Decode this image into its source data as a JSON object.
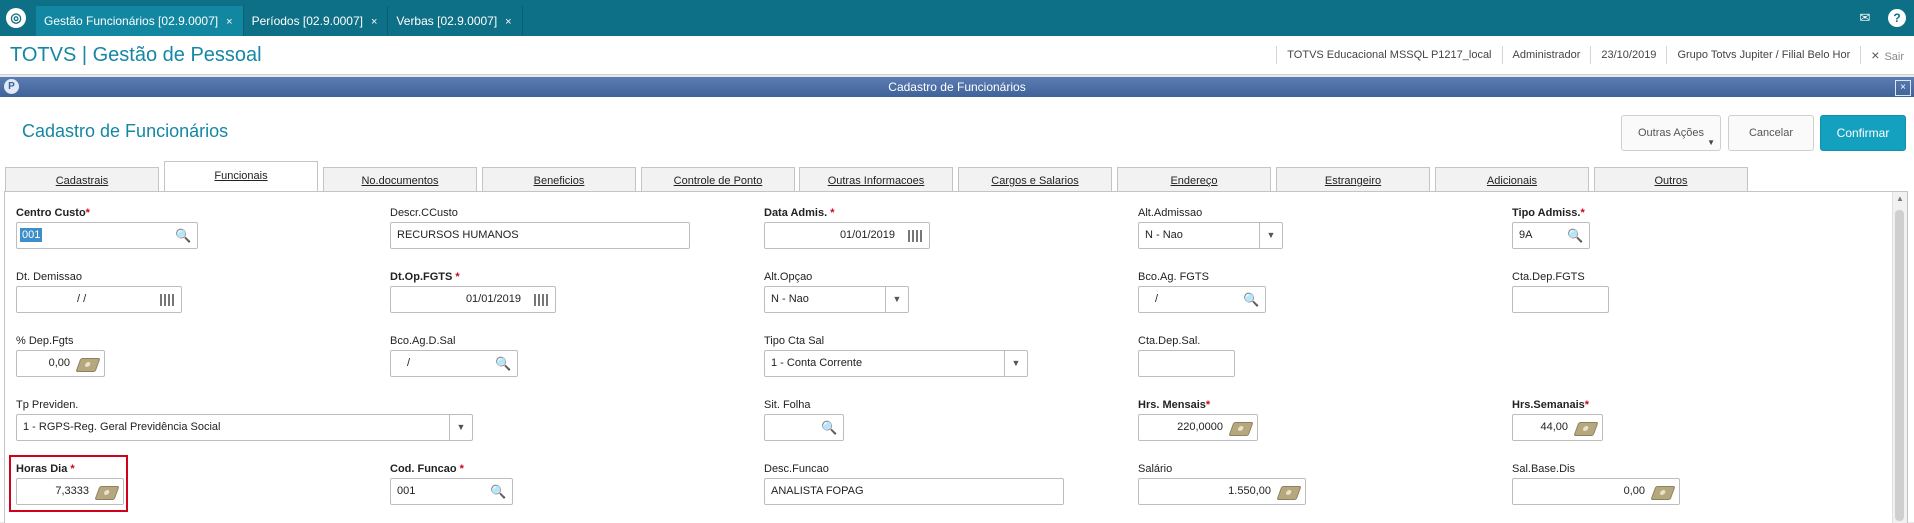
{
  "topbar": {
    "tabs": [
      {
        "label": "Gestão Funcionários [02.9.0007]",
        "close": "×"
      },
      {
        "label": "Períodos [02.9.0007]",
        "close": "×"
      },
      {
        "label": "Verbas [02.9.0007]",
        "close": "×"
      }
    ],
    "icons": [
      "mail-icon",
      "help-icon"
    ]
  },
  "appbar": {
    "title": "TOTVS | Gestão de Pessoal",
    "environment": "TOTVS Educacional MSSQL P1217_local",
    "user": "Administrador",
    "date": "23/10/2019",
    "company": "Grupo Totvs Jupiter / Filial Belo Hor",
    "logout": "Sair",
    "logout_icon": "×"
  },
  "dialog": {
    "window_title": "Cadastro de Funcionários",
    "title": "Cadastro de Funcionários",
    "actions": {
      "more": "Outras Ações",
      "cancel": "Cancelar",
      "confirm": "Confirmar"
    },
    "tabs": [
      "Cadastrais",
      "Funcionais",
      "No.documentos",
      "Beneficios",
      "Controle de Ponto",
      "Outras Informacoes",
      "Cargos e Salarios",
      "Endereço",
      "Estrangeiro",
      "Adicionais",
      "Outros"
    ],
    "active_tab": "Funcionais"
  },
  "fields": {
    "centro_custo": {
      "label": "Centro Custo",
      "required": "*",
      "value": "001"
    },
    "descr_ccusto": {
      "label": "Descr.CCusto",
      "value": "RECURSOS HUMANOS"
    },
    "data_admis": {
      "label": "Data Admis.",
      "required": "*",
      "value": "01/01/2019"
    },
    "alt_admissao": {
      "label": "Alt.Admissao",
      "value": "N - Nao"
    },
    "tipo_admis": {
      "label": "Tipo Admiss.",
      "required": "*",
      "value": "9A"
    },
    "dt_demissao": {
      "label": "Dt. Demissao",
      "value": "/  /"
    },
    "dt_op_fgts": {
      "label": "Dt.Op.FGTS",
      "required": "*",
      "value": "01/01/2019"
    },
    "alt_opcao": {
      "label": "Alt.Opçao",
      "value": "N - Nao"
    },
    "bco_ag_fgts": {
      "label": "Bco.Ag. FGTS",
      "value": "/"
    },
    "cta_dep_fgts": {
      "label": "Cta.Dep.FGTS",
      "value": ""
    },
    "pct_dep_fgts": {
      "label": "% Dep.Fgts",
      "value": "0,00"
    },
    "bco_ag_d_sal": {
      "label": "Bco.Ag.D.Sal",
      "value": "/"
    },
    "tipo_cta_sal": {
      "label": "Tipo Cta Sal",
      "value": "1 - Conta Corrente"
    },
    "cta_dep_sal": {
      "label": "Cta.Dep.Sal.",
      "value": ""
    },
    "tp_providen": {
      "label": "Tp Previden.",
      "value": "1 - RGPS-Reg. Geral Previdência Social"
    },
    "sit_folha": {
      "label": "Sit. Folha",
      "value": ""
    },
    "hrs_mensais": {
      "label": "Hrs. Mensais",
      "required": "*",
      "value": "220,0000"
    },
    "hrs_semanais": {
      "label": "Hrs.Semanais",
      "required": "*",
      "value": "44,00"
    },
    "horas_dia": {
      "label": "Horas Dia",
      "required": "*",
      "value": "7,3333"
    },
    "cod_funcao": {
      "label": "Cod. Funcao",
      "required": "*",
      "value": "001"
    },
    "desc_funcao": {
      "label": "Desc.Funcao",
      "value": "ANALISTA FOPAG"
    },
    "salario": {
      "label": "Salário",
      "value": "1.550,00"
    },
    "sal_base_dis": {
      "label": "Sal.Base.Dis",
      "value": "0,00"
    }
  }
}
